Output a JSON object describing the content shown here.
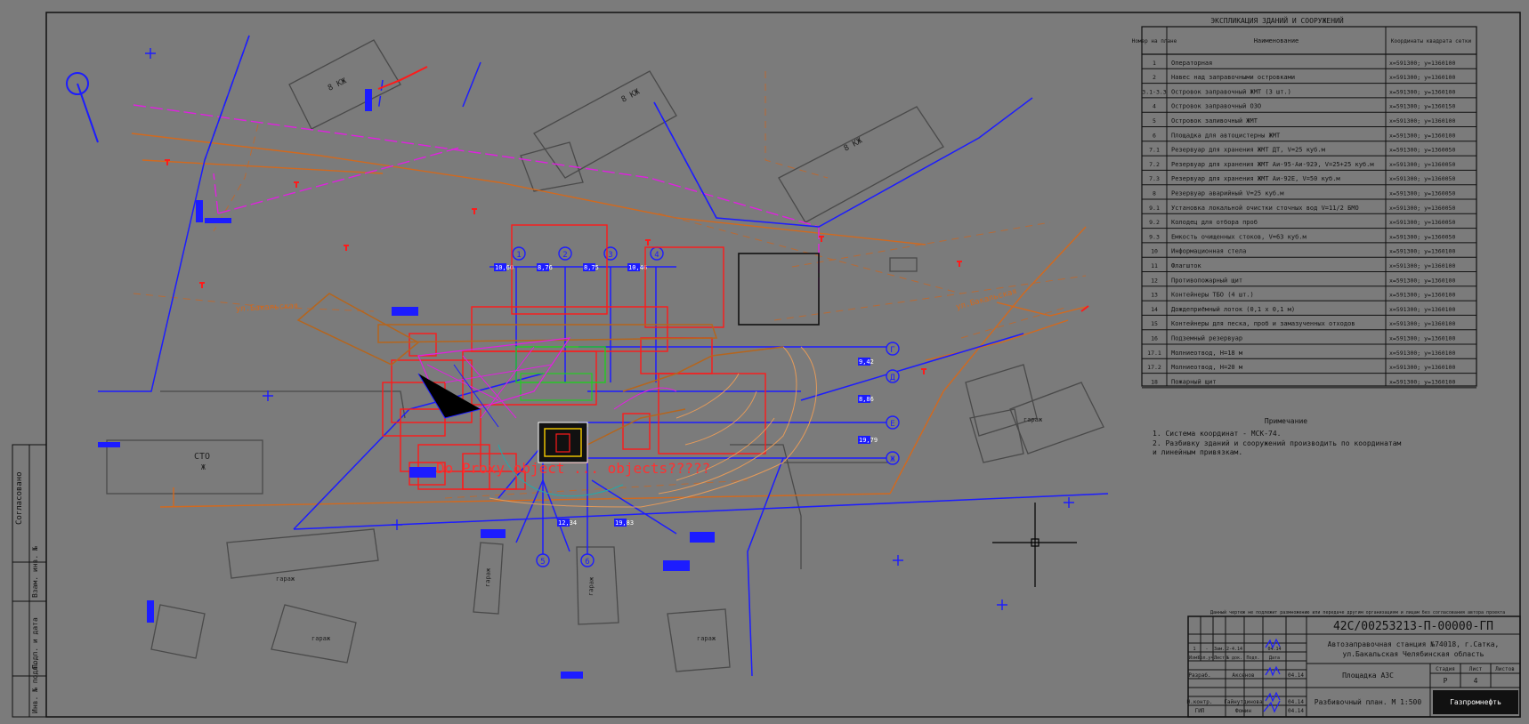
{
  "drawing": {
    "code": "42С/00253213-П-00000-ГП",
    "project_line1": "Автозаправочная станция №74018, г.Сатка,",
    "project_line2": "ул.Бакальская Челябинская область",
    "sheet_title": "Площадка АЗС",
    "drawing_title": "Разбивочный план. М 1:500",
    "stage": "Р",
    "sheet": "4",
    "stage_label": "Стадия",
    "sheet_label": "Лист",
    "sheets_label": "Листов",
    "top_note": "Данный чертеж не подлежит размножению или передаче другим организациям и лицам без согласования автора проекта",
    "logo_text": "Газпромнефть"
  },
  "stamp_rows": {
    "rev_row": [
      "1",
      "-",
      "Зам.",
      "2-4.14",
      "",
      "04.14"
    ],
    "header": [
      "Изм.",
      "Кол.уч.",
      "Лист",
      "№ док.",
      "Подп.",
      "Дата"
    ],
    "dev": [
      "Разраб.",
      "Аксенов",
      "",
      "04.14"
    ],
    "norm": [
      "Н.контр.",
      "Гайнутдинова",
      "",
      "04.14"
    ],
    "gip": [
      "ГИП",
      "Фомин",
      "",
      "04.14"
    ]
  },
  "side_labels": [
    "Согласовано",
    "Взам. инв. №",
    "Подп. и дата",
    "Инв. № подл."
  ],
  "explication": {
    "title": "ЭКСПЛИКАЦИЯ ЗДАНИЙ И СООРУЖЕНИЙ",
    "headers": [
      "Номер на плане",
      "Наименование",
      "Координаты квадрата сетки"
    ],
    "rows": [
      [
        "1",
        "Операторная",
        "x=591300; y=1360100"
      ],
      [
        "2",
        "Навес над заправочными островками",
        "x=591300; y=1360100"
      ],
      [
        "3.1-3.3",
        "Островок заправочный ЖМТ (3 шт.)",
        "x=591300; y=1360100"
      ],
      [
        "4",
        "Островок заправочный ОЗО",
        "x=591300; y=1360150"
      ],
      [
        "5",
        "Островок заливочный ЖМТ",
        "x=591300; y=1360100"
      ],
      [
        "6",
        "Площадка для автоцистерны ЖМТ",
        "x=591300; y=1360100"
      ],
      [
        "7.1",
        "Резервуар для хранения ЖМТ ДТ, V=25 куб.м",
        "x=591300; y=1360050"
      ],
      [
        "7.2",
        "Резервуар для хранения ЖМТ Аи-95-Аи-92Э, V=25+25 куб.м",
        "x=591300; y=1360050"
      ],
      [
        "7.3",
        "Резервуар для хранения ЖМТ Аи-92Е, V=50 куб.м",
        "x=591300; y=1360050"
      ],
      [
        "8",
        "Резервуар аварийный V=25 куб.м",
        "x=591300; y=1360050"
      ],
      [
        "9.1",
        "Установка локальной очистки сточных вод V=11/2 БМО",
        "x=591300; y=1360050"
      ],
      [
        "9.2",
        "Колодец для отбора проб",
        "x=591300; y=1360050"
      ],
      [
        "9.3",
        "Емкость очищенных стоков, V=63 куб.м",
        "x=591300; y=1360050"
      ],
      [
        "10",
        "Информационная стела",
        "x=591300; y=1360100"
      ],
      [
        "11",
        "Флагшток",
        "x=591300; y=1360100"
      ],
      [
        "12",
        "Противопожарный щит",
        "x=591300; y=1360100"
      ],
      [
        "13",
        "Контейнеры ТБО (4 шт.)",
        "x=591300; y=1360100"
      ],
      [
        "14",
        "Дождеприёмный лоток (0,1 x 0,1 м)",
        "x=591300; y=1360100"
      ],
      [
        "15",
        "Контейнеры для песка, проб и замазученных отходов",
        "x=591300; y=1360100"
      ],
      [
        "16",
        "Подземный резервуар",
        "x=591300; y=1360100"
      ],
      [
        "17.1",
        "Молниеотвод, Н=18 м",
        "x=591300; y=1360100"
      ],
      [
        "17.2",
        "Молниеотвод, Н=20 м",
        "x=591300; y=1360100"
      ],
      [
        "18",
        "Пожарный щит",
        "x=591300; y=1360100"
      ]
    ]
  },
  "notes": {
    "title": "Примечание",
    "lines": [
      "1. Система координат - МСК-74.",
      "2. Разбивку зданий и сооружений производить по координатам",
      "   и линейным привязкам."
    ]
  },
  "plan_labels": {
    "street1": "ул.Бакальская",
    "street2": "ул.Бакальская",
    "building1": "8 КЖ",
    "building2": "8 КЖ",
    "building3": "8 КЖ",
    "building4": "СТО",
    "building4b": "Ж",
    "proxy_warning": "Do Proxy object ... objects?????",
    "garage1": "гараж",
    "garage2": "гараж",
    "garage3": "гараж",
    "garage4": "гараж",
    "garage5": "гараж",
    "garage6": "гараж",
    "axes": [
      "1",
      "2",
      "3",
      "4",
      "5",
      "6",
      "Г",
      "Д",
      "Е",
      "Ж"
    ],
    "dims": [
      "10,60",
      "8,76",
      "8,75",
      "10,46",
      "9,42",
      "8,86",
      "19,79",
      "12,34",
      "19,83"
    ]
  },
  "colors": {
    "background": "#7b7b7b",
    "blue": "#1c1cff",
    "red": "#ff1a1a",
    "orange": "#d2691e",
    "magenta": "#e020e0",
    "dark": "#5a5a5a"
  }
}
